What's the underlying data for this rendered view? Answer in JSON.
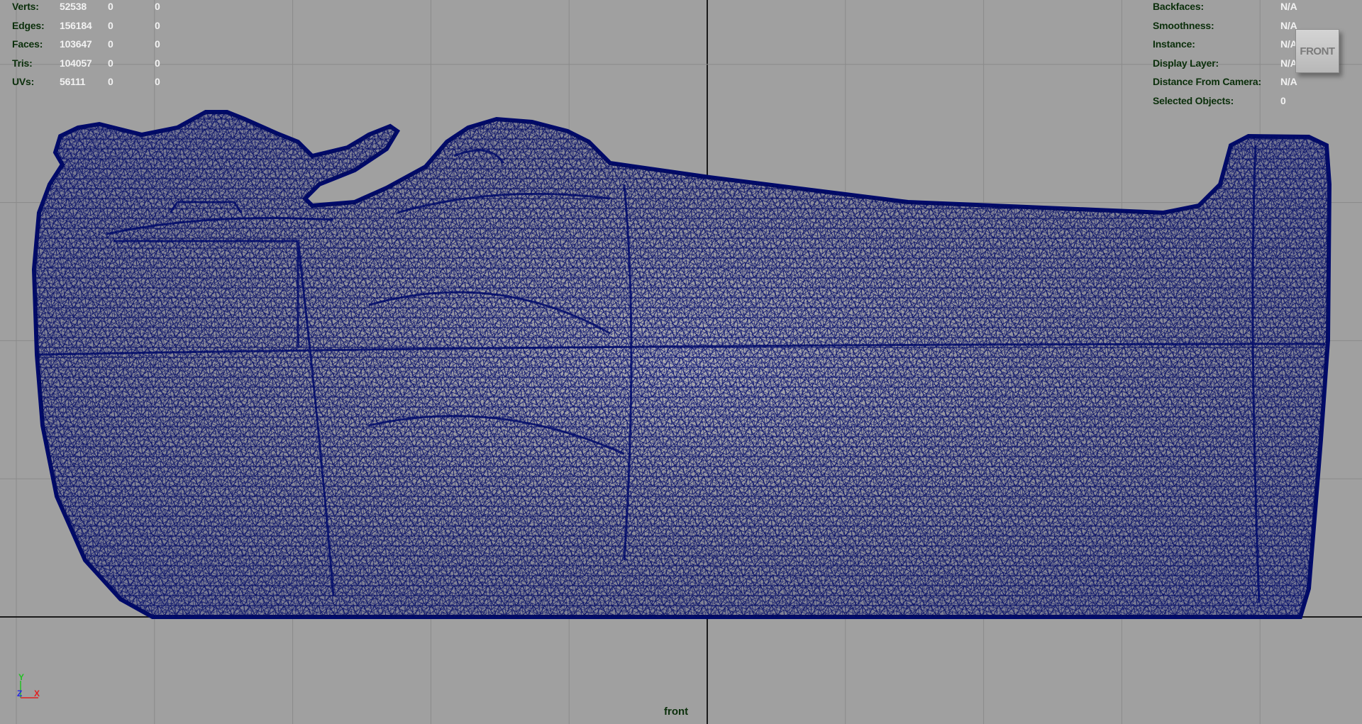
{
  "viewport": {
    "camera_name": "front",
    "view_cube_label": "FRONT",
    "mesh_color": "#000c6e",
    "background_color": "#a0a0a0",
    "grid_color": "#8a8a8a",
    "axis_line_color": "#1a1a1a"
  },
  "poly_count": {
    "rows": [
      {
        "label": "Verts:",
        "values": [
          "52538",
          "0",
          "0"
        ]
      },
      {
        "label": "Edges:",
        "values": [
          "156184",
          "0",
          "0"
        ]
      },
      {
        "label": "Faces:",
        "values": [
          "103647",
          "0",
          "0"
        ]
      },
      {
        "label": "Tris:",
        "values": [
          "104057",
          "0",
          "0"
        ]
      },
      {
        "label": "UVs:",
        "values": [
          "56111",
          "0",
          "0"
        ]
      }
    ]
  },
  "object_details": {
    "rows": [
      {
        "label": "Backfaces:",
        "value": "N/A"
      },
      {
        "label": "Smoothness:",
        "value": "N/A"
      },
      {
        "label": "Instance:",
        "value": "N/A"
      },
      {
        "label": "Display Layer:",
        "value": "N/A"
      },
      {
        "label": "Distance From Camera:",
        "value": "N/A"
      },
      {
        "label": "Selected Objects:",
        "value": "0"
      }
    ]
  },
  "axis_indicator": {
    "y_label": "Y",
    "z_label": "Z",
    "x_label": "X",
    "y_color": "#22c022",
    "z_color": "#2a2ae0",
    "x_color": "#e02020"
  }
}
